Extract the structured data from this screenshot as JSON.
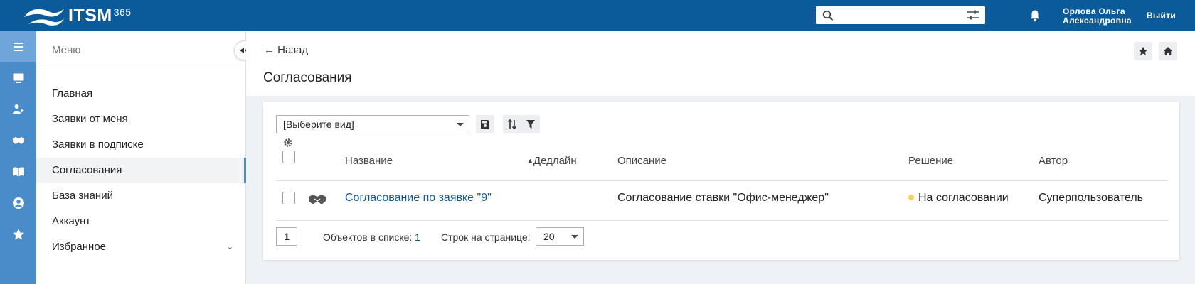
{
  "header": {
    "logo_text": "ITSM",
    "logo_sup": "365",
    "search_placeholder": "",
    "user_name_line1": "Орлова Ольга",
    "user_name_line2": "Александровна",
    "logout_label": "Выйти"
  },
  "rail": {
    "icons": [
      "menu-icon",
      "monitor-icon",
      "user-arrow-icon",
      "handshake-icon",
      "book-icon",
      "account-circle-icon",
      "star-icon"
    ]
  },
  "menu": {
    "title": "Меню",
    "items": [
      {
        "label": "Главная"
      },
      {
        "label": "Заявки от меня"
      },
      {
        "label": "Заявки в подписке"
      },
      {
        "label": "Согласования"
      },
      {
        "label": "База знаний"
      },
      {
        "label": "Аккаунт"
      },
      {
        "label": "Избранное"
      }
    ],
    "active_index": 3
  },
  "page": {
    "back_label": "← Назад",
    "title": "Согласования"
  },
  "toolbar": {
    "view_select_value": "[Выберите вид]"
  },
  "table": {
    "columns": [
      "Название",
      "Дедлайн",
      "Описание",
      "Решение",
      "Автор"
    ],
    "rows": [
      {
        "name": "Согласование по заявке \"9\"",
        "deadline": "",
        "description": "Согласование ставки \"Офис-менеджер\"",
        "decision": "На согласовании",
        "author": "Суперпользователь"
      }
    ]
  },
  "pager": {
    "page": "1",
    "objects_label": "Объектов в списке:",
    "objects_count": "1",
    "rows_label": "Строк на странице:",
    "rows_value": "20"
  },
  "colors": {
    "topbar": "#0b5b9a",
    "rail": "#4a8bc9",
    "status_pending": "#f4d35e"
  }
}
